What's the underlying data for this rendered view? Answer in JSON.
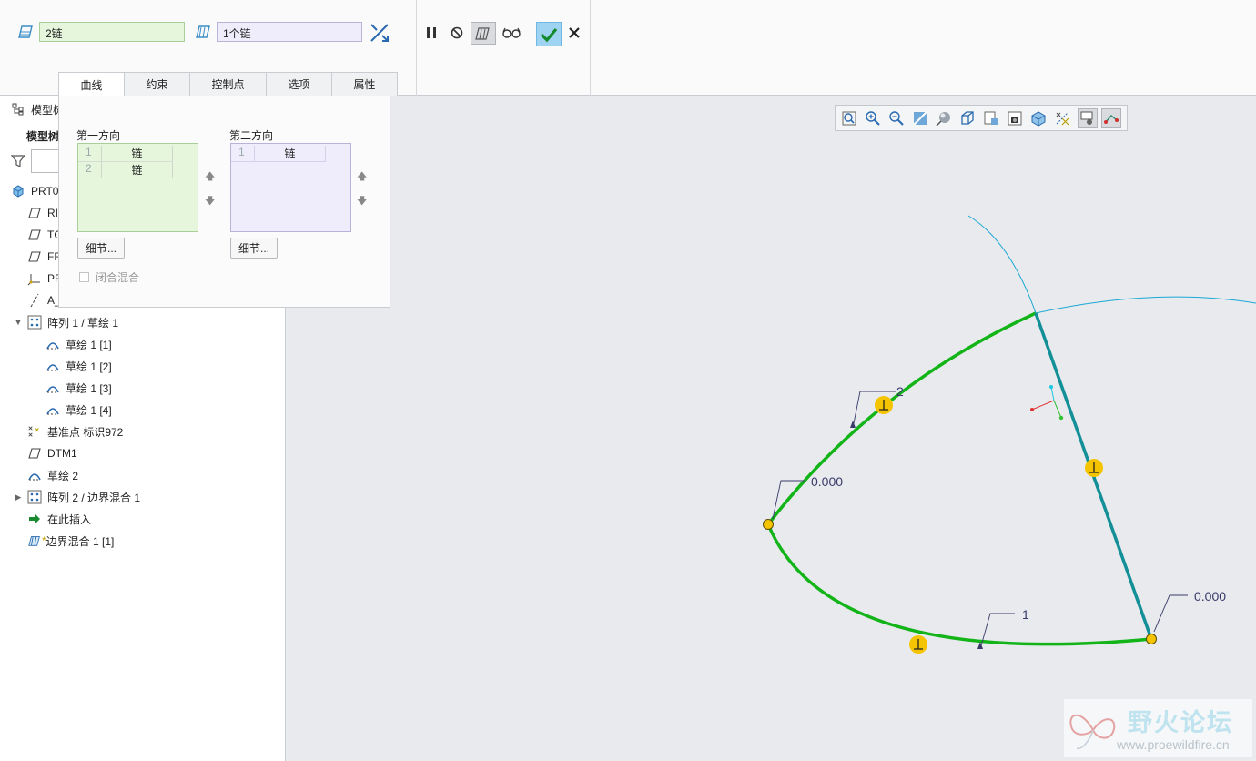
{
  "dashboard": {
    "first_chain_value": "2链",
    "second_chain_value": "1个链"
  },
  "tabs": [
    "曲线",
    "约束",
    "控制点",
    "选项",
    "属性"
  ],
  "panel": {
    "first_direction_label": "第一方向",
    "second_direction_label": "第二方向",
    "first_rows": [
      {
        "n": "1",
        "v": "链"
      },
      {
        "n": "2",
        "v": "链"
      }
    ],
    "second_rows": [
      {
        "n": "1",
        "v": "链"
      }
    ],
    "details_label": "细节...",
    "closed_blend_label": "闭合混合"
  },
  "tree": {
    "header_label": "模型树",
    "sub_label": "模型树",
    "items": [
      {
        "label": "PRT0",
        "icon": "part-icon"
      },
      {
        "label": "RI",
        "icon": "datum-plane-icon"
      },
      {
        "label": "TC",
        "icon": "datum-plane-icon"
      },
      {
        "label": "FF",
        "icon": "datum-plane-icon"
      },
      {
        "label": "PF",
        "icon": "coordinate-system-icon"
      },
      {
        "label": "A_",
        "icon": "datum-axis-icon"
      },
      {
        "label": "阵列 1 / 草绘 1",
        "icon": "pattern-icon"
      },
      {
        "label": "草绘 1 [1]",
        "icon": "sketch-icon"
      },
      {
        "label": "草绘 1 [2]",
        "icon": "sketch-icon"
      },
      {
        "label": "草绘 1 [3]",
        "icon": "sketch-icon"
      },
      {
        "label": "草绘 1 [4]",
        "icon": "sketch-icon"
      },
      {
        "label": "基准点 标识972",
        "icon": "datum-point-icon"
      },
      {
        "label": "DTM1",
        "icon": "datum-plane-icon"
      },
      {
        "label": "草绘 2",
        "icon": "sketch-icon"
      },
      {
        "label": "阵列 2 / 边界混合 1",
        "icon": "pattern-icon"
      },
      {
        "label": "在此插入",
        "icon": "insert-here-icon"
      },
      {
        "label": "边界混合 1 [1]",
        "icon": "boundary-blend-icon"
      }
    ]
  },
  "graphics": {
    "label_chain_2": "2",
    "label_chain_1": "1",
    "value_left": "0.000",
    "value_right": "0.000"
  },
  "watermark": {
    "title": "野火论坛",
    "url": "www.proewildfire.cn"
  },
  "colors": {
    "chain_green": "#12b418",
    "chain_teal": "#138f97",
    "reference_cyan": "#1aa8d4",
    "handle_yellow": "#f5c400",
    "ok_blue": "#9fd3f2"
  }
}
